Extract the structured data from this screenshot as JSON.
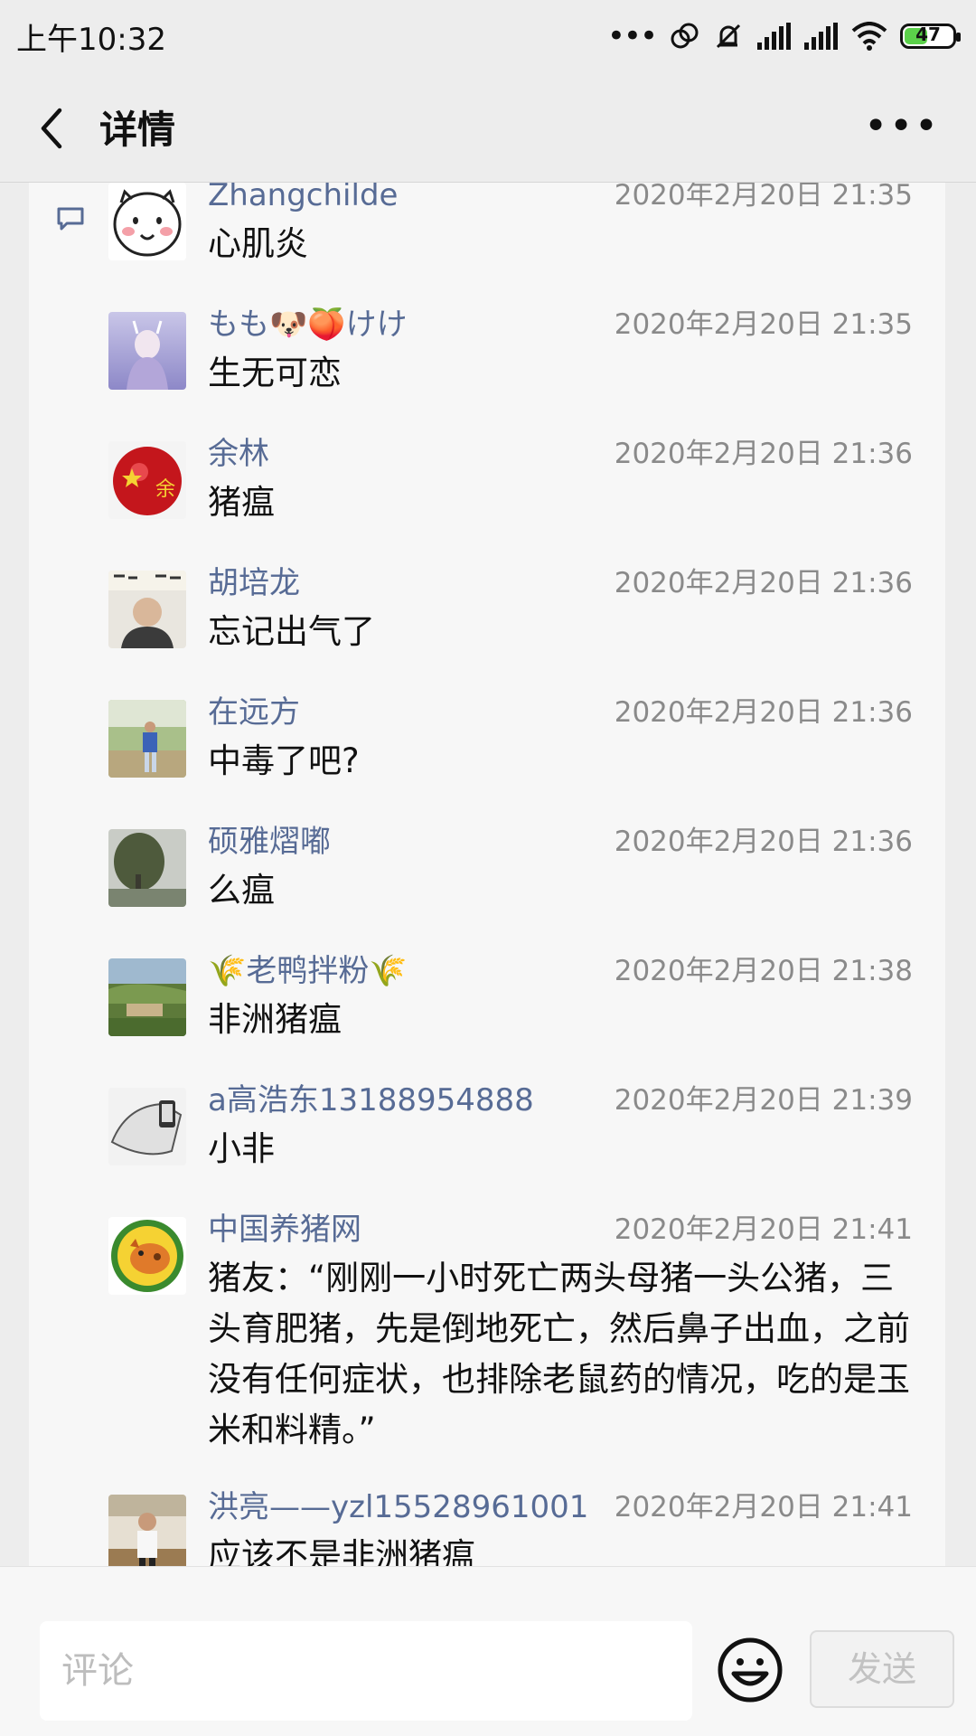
{
  "status": {
    "time": "上午10:32",
    "battery": "47"
  },
  "nav": {
    "title": "详情"
  },
  "comments": [
    {
      "name": "Zhangchilde",
      "time": "2020年2月20日 21:35",
      "text": "心肌炎"
    },
    {
      "name": "もも🐶🍑けけ",
      "time": "2020年2月20日 21:35",
      "text": "生无可恋"
    },
    {
      "name": "余林",
      "time": "2020年2月20日 21:36",
      "text": "猪瘟"
    },
    {
      "name": "胡培龙",
      "time": "2020年2月20日 21:36",
      "text": "忘记出气了"
    },
    {
      "name": "在远方",
      "time": "2020年2月20日 21:36",
      "text": "中毒了吧?"
    },
    {
      "name": "硕雅熠嘟",
      "time": "2020年2月20日 21:36",
      "text": "么瘟"
    },
    {
      "name": "🌾老鸭拌粉🌾",
      "time": "2020年2月20日 21:38",
      "text": "非洲猪瘟"
    },
    {
      "name": "a高浩东13188954888",
      "time": "2020年2月20日 21:39",
      "text": "小非"
    },
    {
      "name": "中国养猪网",
      "time": "2020年2月20日 21:41",
      "text": "猪友：“刚刚一小时死亡两头母猪一头公猪，三头育肥猪，先是倒地死亡，然后鼻子出血，之前没有任何症状，也排除老鼠药的情况，吃的是玉米和料精。”"
    },
    {
      "name": "洪亮——yzl15528961001",
      "time": "2020年2月20日 21:41",
      "text": "应该不是非洲猪瘟"
    }
  ],
  "composer": {
    "placeholder": "评论",
    "send_label": "发送"
  }
}
